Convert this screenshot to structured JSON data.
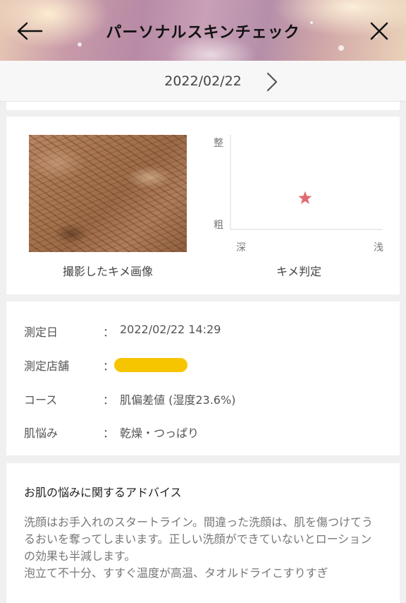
{
  "header": {
    "title": "パーソナルスキンチェック",
    "back_icon": "arrow-left-icon",
    "close_icon": "close-icon"
  },
  "date_nav": {
    "date": "2022/02/22",
    "next_icon": "chevron-right-icon"
  },
  "skin_image": {
    "caption": "撮影したキメ画像"
  },
  "kime_chart": {
    "caption": "キメ判定",
    "y_top_label": "整",
    "y_bottom_label": "粗",
    "x_left_label": "深",
    "x_right_label": "浅",
    "marker_color": "#e06b70"
  },
  "chart_data": {
    "type": "scatter",
    "title": "キメ判定",
    "x_tick_labels": [
      "深",
      "浅"
    ],
    "y_tick_labels": [
      "粗",
      "整"
    ],
    "xlim": [
      0,
      1
    ],
    "ylim": [
      0,
      1
    ],
    "series": [
      {
        "points": [
          {
            "x": 0.49,
            "y": 0.33
          }
        ],
        "marker": "star",
        "color": "#e06b70"
      }
    ],
    "grid": false
  },
  "info": {
    "separator": "：",
    "rows": [
      {
        "label": "測定日",
        "value": "2022/02/22 14:29"
      },
      {
        "label": "測定店舗",
        "value": ""
      },
      {
        "label": "コース",
        "value": "肌偏差値 (湿度23.6%)"
      },
      {
        "label": "肌悩み",
        "value": "乾燥・つっぱり"
      }
    ],
    "redaction_color": "#f7c400"
  },
  "advice": {
    "title": "お肌の悩みに関するアドバイス",
    "body": "洗顔はお手入れのスタートライン。間違った洗顔は、肌を傷つけてうるおいを奪ってしまいます。正しい洗顔ができていないとローションの効果も半減します。\n泡立て不十分、すすぐ温度が高温、タオルドライこすりすぎ"
  }
}
